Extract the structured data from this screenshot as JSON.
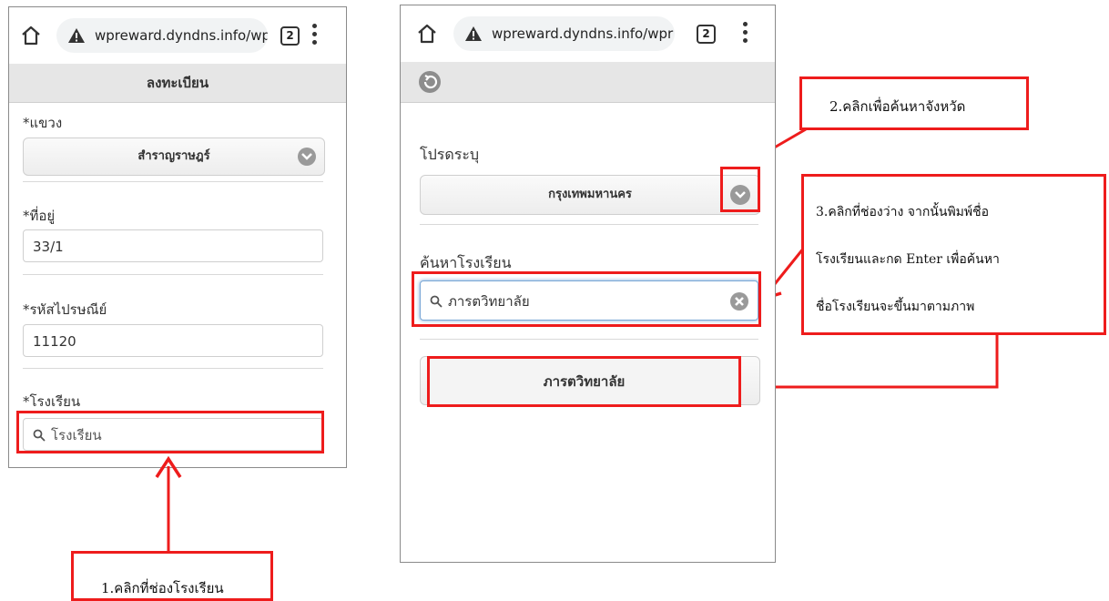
{
  "browser": {
    "url": "wpreward.dyndns.info/wpr",
    "tab_count": "2"
  },
  "left_screen": {
    "page_title": "ลงทะเบียน",
    "district": {
      "label": "*แขวง",
      "value": "สำราญราษฎร์"
    },
    "address": {
      "label": "*ที่อยู่",
      "value": "33/1"
    },
    "postcode": {
      "label": "*รหัสไปรษณีย์",
      "value": "11120"
    },
    "school": {
      "label": "*โรงเรียน",
      "placeholder": "โรงเรียน"
    }
  },
  "right_screen": {
    "province": {
      "label": "โปรดระบุ",
      "value": "กรุงเทพมหานคร"
    },
    "school_search": {
      "label": "ค้นหาโรงเรียน",
      "value": "ภารตวิทยาลัย"
    },
    "result": "ภารตวิทยาลัย"
  },
  "callouts": {
    "step1": "1.คลิกที่ช่องโรงเรียน",
    "step2": "2.คลิกเพื่อค้นหาจังหวัด",
    "step3_line1": "3.คลิกที่ช่องว่าง จากนั้นพิมพ์ชื่อ",
    "step3_line2": "โรงเรียนและกด Enter เพื่อค้นหา",
    "step3_line3": "ชื่อโรงเรียนจะขึ้นมาตามภาพ"
  },
  "colors": {
    "annotation_red": "#ee1c1c",
    "header_gray": "#e6e6e6"
  }
}
